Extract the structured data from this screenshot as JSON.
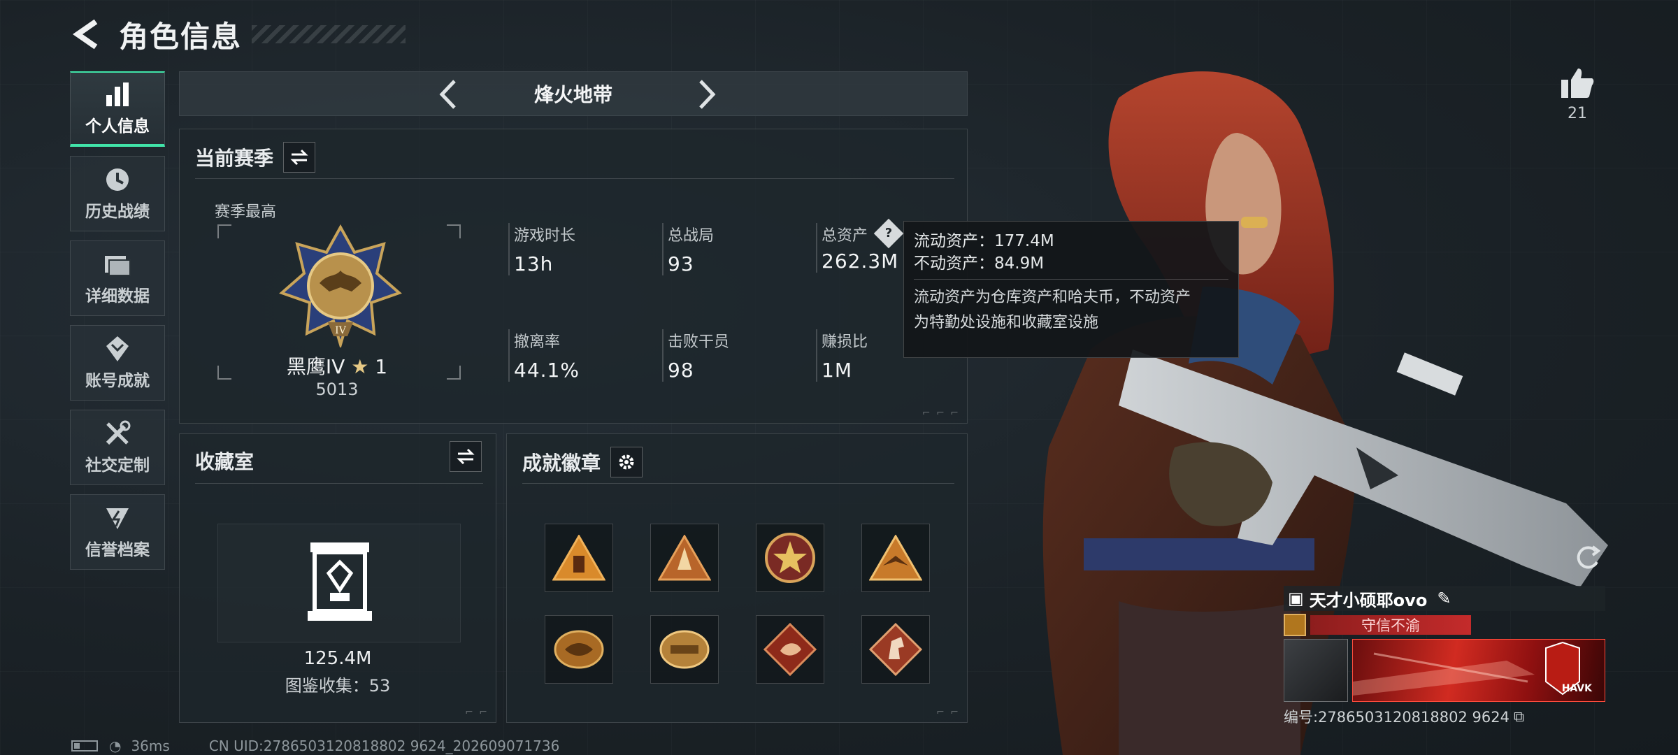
{
  "header": {
    "title": "角色信息"
  },
  "sidebar": {
    "items": [
      {
        "label": "个人信息",
        "icon": "bar-chart-icon",
        "active": true
      },
      {
        "label": "历史战绩",
        "icon": "clock-icon"
      },
      {
        "label": "详细数据",
        "icon": "folder-icon"
      },
      {
        "label": "账号成就",
        "icon": "achievement-icon"
      },
      {
        "label": "社交定制",
        "icon": "tools-icon"
      },
      {
        "label": "信誉档案",
        "icon": "shield-icon"
      }
    ]
  },
  "mode": {
    "title": "烽火地带"
  },
  "season": {
    "title": "当前赛季",
    "best_label": "赛季最高",
    "rank_name": "黑鹰IV",
    "rank_stars": "1",
    "rank_score": "5013",
    "stats": [
      {
        "label": "游戏时长",
        "value": "13h"
      },
      {
        "label": "总战局",
        "value": "93"
      },
      {
        "label": "总资产",
        "value": "262.3M"
      },
      {
        "label": "撤离率",
        "value": "44.1%"
      },
      {
        "label": "击败干员",
        "value": "98"
      },
      {
        "label": "赚损比",
        "value": "1M"
      }
    ]
  },
  "tooltip": {
    "liquid": "流动资产：177.4M",
    "fixed": "不动资产：84.9M",
    "desc1": "流动资产为仓库资产和哈夫币，不动资产",
    "desc2": "为特勤处设施和收藏室设施"
  },
  "collection": {
    "title": "收藏室",
    "value": "125.4M",
    "count": "图鉴收集：53"
  },
  "badges": {
    "title": "成就徽章"
  },
  "footer": {
    "ping": "36ms",
    "uid": "CN UID:2786503120818802 9624_202609071736"
  },
  "like": {
    "count": "21"
  },
  "player": {
    "name": "天才小硕耶ovo",
    "title_tag": "守信不渝",
    "card_brand": "HAVK",
    "id": "编号:2786503120818802 9624"
  },
  "colors": {
    "accent": "#41e4a9",
    "card_red": "#d12b21"
  }
}
